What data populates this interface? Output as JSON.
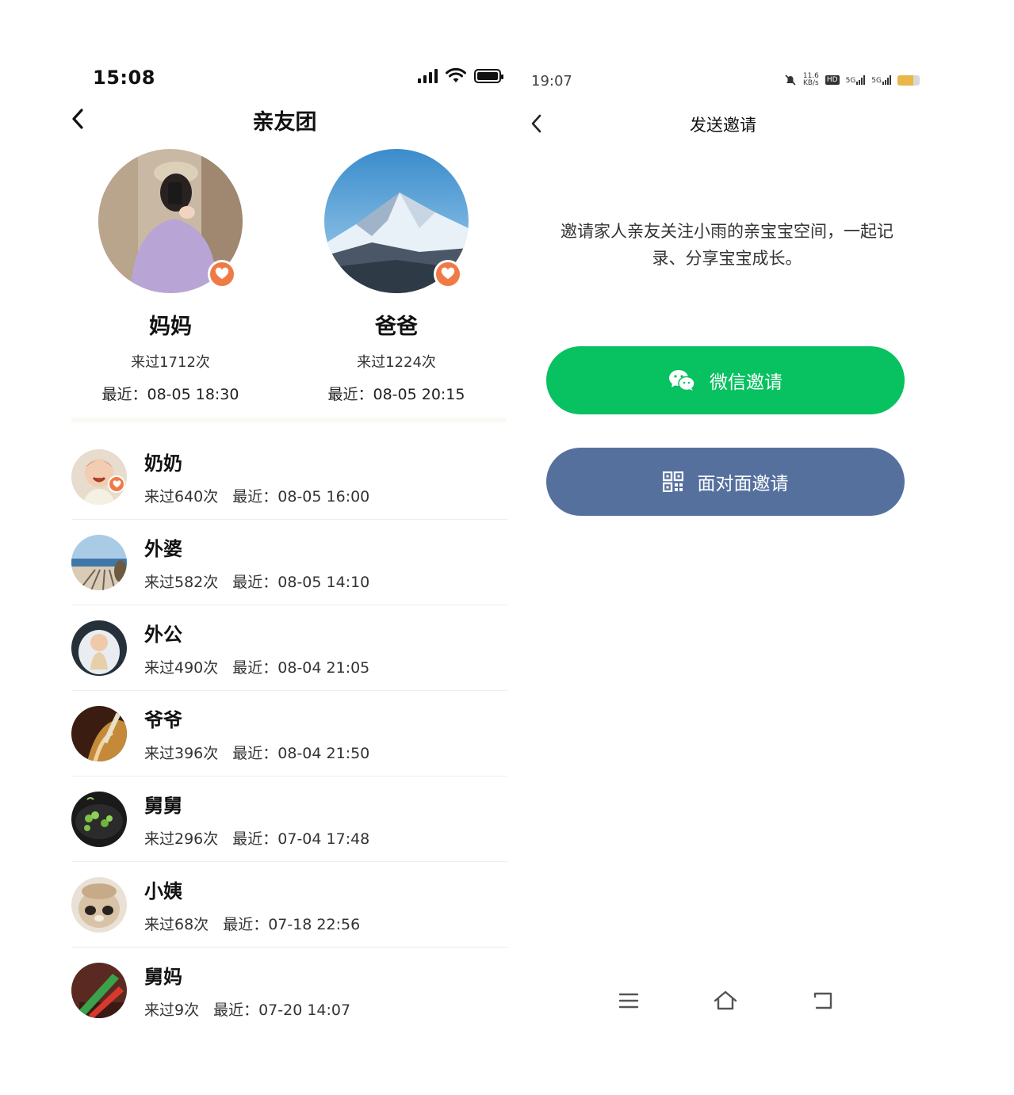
{
  "left": {
    "status_time": "15:08",
    "title": "亲友团",
    "top_members": [
      {
        "name": "妈妈",
        "count": "来过1712次",
        "last": "最近：08-05 18:30"
      },
      {
        "name": "爸爸",
        "count": "来过1224次",
        "last": "最近：08-05 20:15"
      }
    ],
    "members": [
      {
        "name": "奶奶",
        "count": "来过640次",
        "last": "最近：08-05 16:00"
      },
      {
        "name": "外婆",
        "count": "来过582次",
        "last": "最近：08-05 14:10"
      },
      {
        "name": "外公",
        "count": "来过490次",
        "last": "最近：08-04 21:05"
      },
      {
        "name": "爷爷",
        "count": "来过396次",
        "last": "最近：08-04 21:50"
      },
      {
        "name": "舅舅",
        "count": "来过296次",
        "last": "最近：07-04 17:48"
      },
      {
        "name": "小姨",
        "count": "来过68次",
        "last": "最近：07-18 22:56"
      },
      {
        "name": "舅妈",
        "count": "来过9次",
        "last": "最近：07-20 14:07"
      }
    ]
  },
  "right": {
    "status_time": "19:07",
    "status_speed": "11.6",
    "status_speed_unit": "KB/s",
    "status_hd": "HD",
    "status_5g_a": "5G",
    "status_5g_b": "5G",
    "title": "发送邀请",
    "description": "邀请家人亲友关注小雨的亲宝宝空间，一起记录、分享宝宝成长。",
    "wechat_button": "微信邀请",
    "f2f_button": "面对面邀请"
  },
  "colors": {
    "heart_badge": "#f07a45",
    "wechat_green": "#08c160",
    "f2f_blue": "#56709e"
  },
  "icons": [
    "back-chevron-icon",
    "heart-icon",
    "wechat-icon",
    "qr-grid-icon",
    "menu-icon",
    "home-icon",
    "return-icon",
    "signal-icon",
    "wifi-icon",
    "battery-icon",
    "mute-bell-icon"
  ]
}
